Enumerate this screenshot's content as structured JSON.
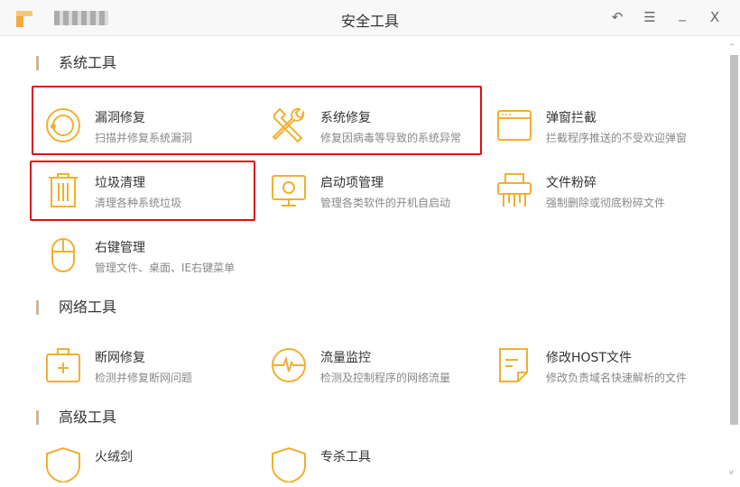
{
  "window": {
    "title": "安全工具",
    "brand": "火绒"
  },
  "controls": {
    "back": "↶",
    "menu": "☰",
    "minimize": "_",
    "close": "X"
  },
  "sections": [
    {
      "title": "系统工具",
      "items": [
        {
          "title": "漏洞修复",
          "desc": "扫描并修复系统漏洞",
          "icon": "vulnerability-icon"
        },
        {
          "title": "系统修复",
          "desc": "修复因病毒等导致的系统异常",
          "icon": "tools-icon"
        },
        {
          "title": "弹窗拦截",
          "desc": "拦截程序推送的不受欢迎弹窗",
          "icon": "window-icon"
        },
        {
          "title": "垃圾清理",
          "desc": "清理各种系统垃圾",
          "icon": "trash-icon"
        },
        {
          "title": "启动项管理",
          "desc": "管理各类软件的开机自启动",
          "icon": "monitor-icon"
        },
        {
          "title": "文件粉碎",
          "desc": "强制删除或彻底粉碎文件",
          "icon": "shredder-icon"
        },
        {
          "title": "右键管理",
          "desc": "管理文件、桌面、IE右键菜单",
          "icon": "mouse-icon"
        }
      ]
    },
    {
      "title": "网络工具",
      "items": [
        {
          "title": "断网修复",
          "desc": "检测并修复断网问题",
          "icon": "first-aid-icon"
        },
        {
          "title": "流量监控",
          "desc": "检测及控制程序的网络流量",
          "icon": "pulse-icon"
        },
        {
          "title": "修改HOST文件",
          "desc": "修改负责域名快速解析的文件",
          "icon": "document-icon"
        }
      ]
    },
    {
      "title": "高级工具",
      "items": [
        {
          "title": "火绒剑",
          "icon": "shield-icon"
        },
        {
          "title": "专杀工具",
          "icon": "shield-icon"
        }
      ]
    }
  ],
  "colors": {
    "accent": "#f0b030",
    "highlight": "#e01010"
  }
}
